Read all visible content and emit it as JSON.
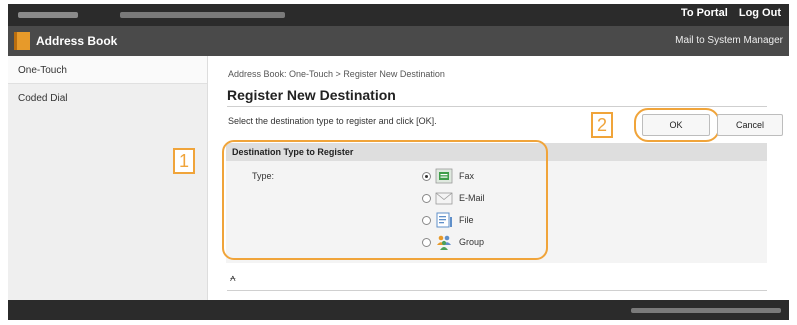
{
  "topbar": {
    "links": [
      "To Portal",
      "Log Out"
    ]
  },
  "titlebar": {
    "title": "Address Book",
    "mail_link": "Mail to System Manager"
  },
  "sidebar": {
    "items": [
      {
        "label": "One-Touch",
        "active": true
      },
      {
        "label": "Coded Dial",
        "active": false
      }
    ]
  },
  "main": {
    "breadcrumb": "Address Book: One-Touch > Register New Destination",
    "title": "Register New Destination",
    "instruction": "Select the destination type to register and click [OK].",
    "ok_label": "OK",
    "cancel_label": "Cancel",
    "section_title": "Destination Type to Register",
    "type_label": "Type:",
    "options": [
      {
        "label": "Fax",
        "icon": "fax-icon",
        "selected": true
      },
      {
        "label": "E-Mail",
        "icon": "envelope-icon",
        "selected": false
      },
      {
        "label": "File",
        "icon": "file-icon",
        "selected": false
      },
      {
        "label": "Group",
        "icon": "group-icon",
        "selected": false
      }
    ],
    "to_top": "⩜"
  },
  "callouts": {
    "one": "1",
    "two": "2"
  },
  "colors": {
    "accent": "#f0a43a",
    "header_dark": "#2b2b2b",
    "titlebar": "#4a4a4a"
  }
}
